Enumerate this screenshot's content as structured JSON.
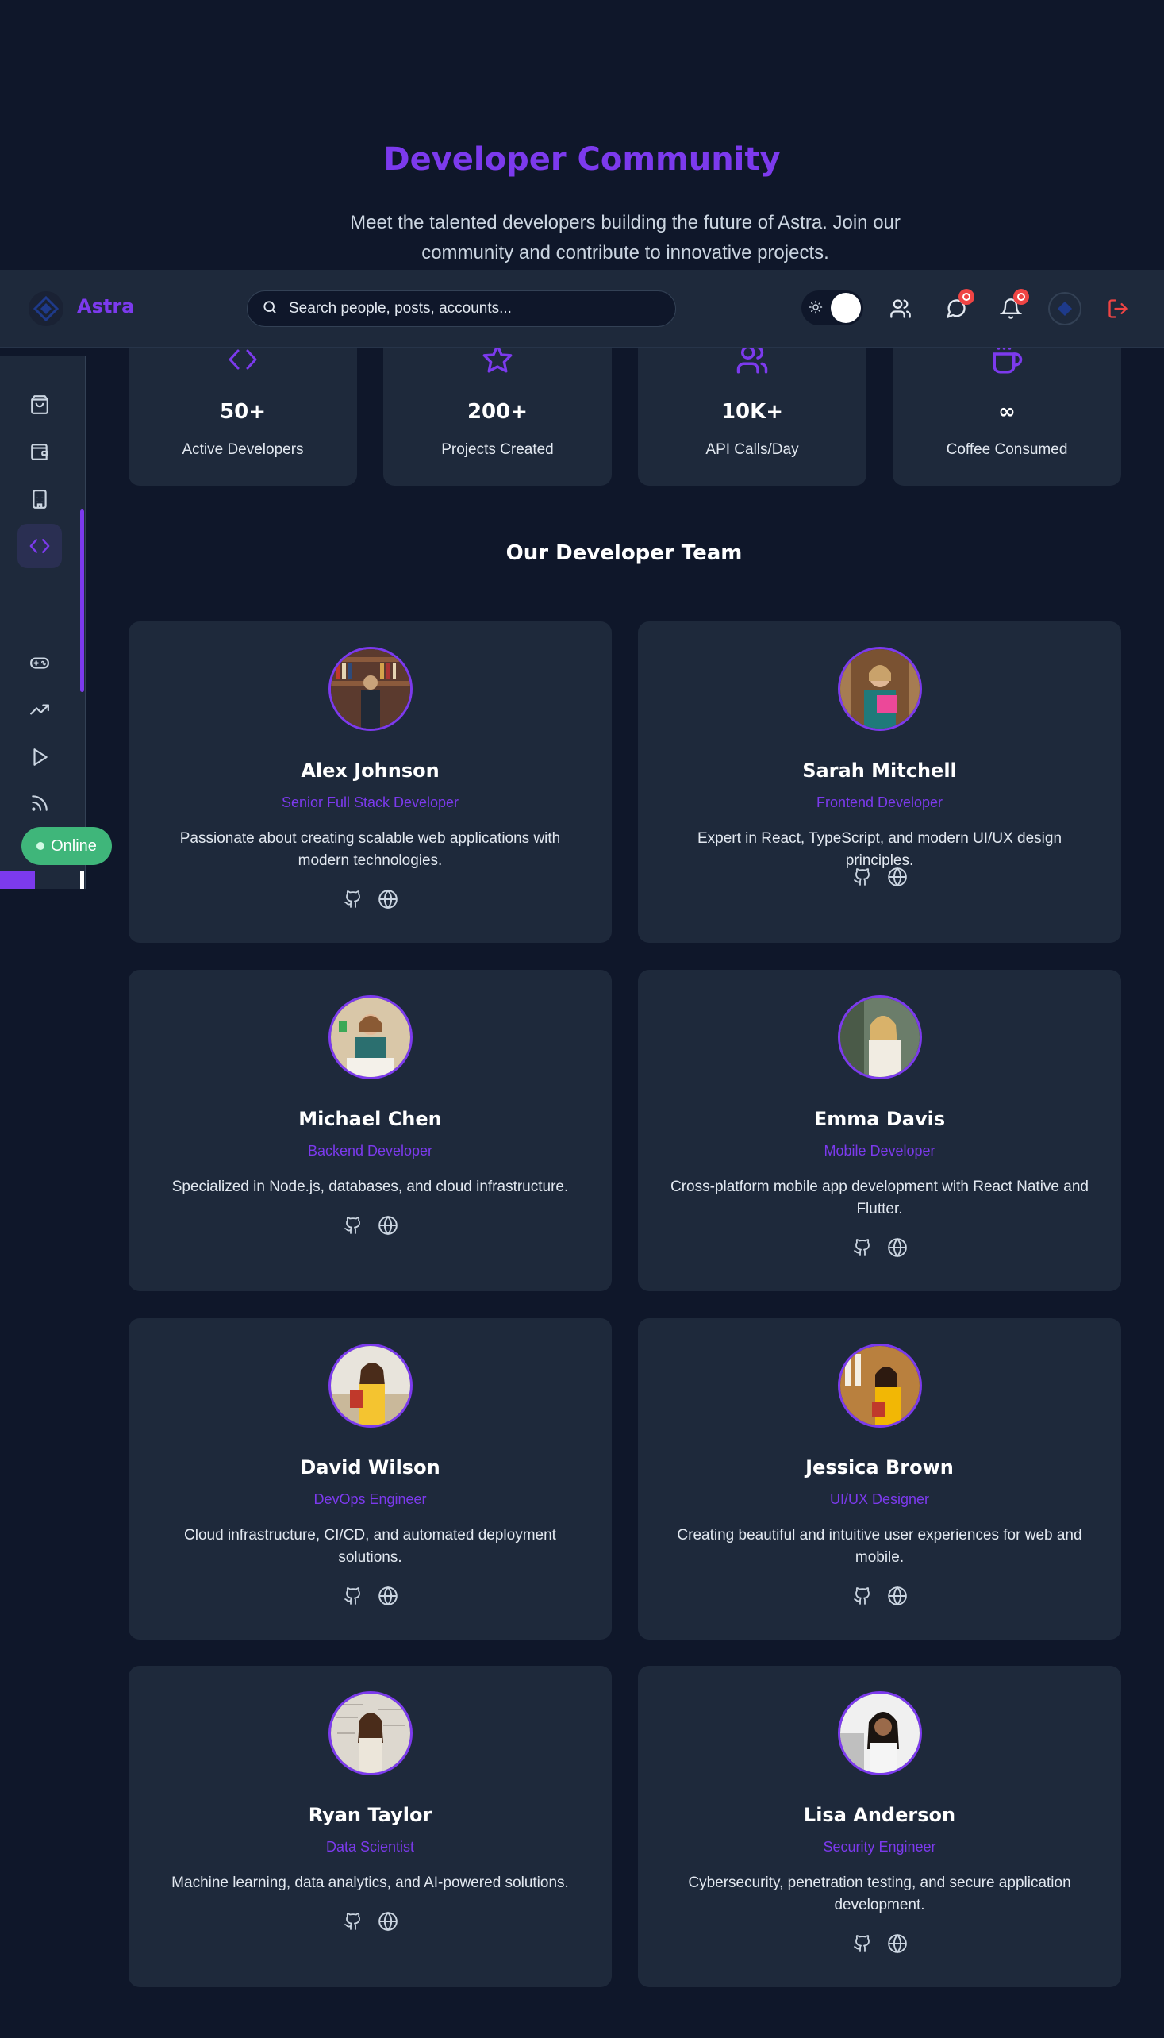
{
  "hero": {
    "title": "Developer Community",
    "subtitle": "Meet the talented developers building the future of Astra. Join our community and contribute to innovative projects."
  },
  "topbar": {
    "brand": "Astra",
    "search_placeholder": "Search people, posts, accounts...",
    "icons": [
      "users-icon",
      "messages-icon",
      "bell-icon",
      "avatar",
      "logout-icon"
    ],
    "theme_toggle": "light"
  },
  "sidebar": {
    "items": [
      "shopping-bag-icon",
      "wallet-icon",
      "building-icon",
      "code-icon",
      "gamepad-icon",
      "trending-up-icon",
      "play-icon",
      "rss-icon"
    ],
    "active": "code-icon",
    "status": "Online"
  },
  "stats": [
    {
      "icon": "code-icon",
      "value": "50+",
      "label": "Active Developers"
    },
    {
      "icon": "star-icon",
      "value": "200+",
      "label": "Projects Created"
    },
    {
      "icon": "users-icon",
      "value": "10K+",
      "label": "API Calls/Day"
    },
    {
      "icon": "coffee-icon",
      "value": "∞",
      "label": "Coffee Consumed"
    }
  ],
  "team": {
    "title": "Our Developer Team",
    "members": [
      {
        "name": "Alex Johnson",
        "role": "Senior Full Stack Developer",
        "bio": "Passionate about creating scalable web applications with modern technologies."
      },
      {
        "name": "Sarah Mitchell",
        "role": "Frontend Developer",
        "bio": "Expert in React, TypeScript, and modern UI/UX design principles."
      },
      {
        "name": "Michael Chen",
        "role": "Backend Developer",
        "bio": "Specialized in Node.js, databases, and cloud infrastructure."
      },
      {
        "name": "Emma Davis",
        "role": "Mobile Developer",
        "bio": "Cross-platform mobile app development with React Native and Flutter."
      },
      {
        "name": "David Wilson",
        "role": "DevOps Engineer",
        "bio": "Cloud infrastructure, CI/CD, and automated deployment solutions."
      },
      {
        "name": "Jessica Brown",
        "role": "UI/UX Designer",
        "bio": "Creating beautiful and intuitive user experiences for web and mobile."
      },
      {
        "name": "Ryan Taylor",
        "role": "Data Scientist",
        "bio": "Machine learning, data analytics, and AI-powered solutions."
      },
      {
        "name": "Lisa Anderson",
        "role": "Security Engineer",
        "bio": "Cybersecurity, penetration testing, and secure application development."
      }
    ]
  },
  "colors": {
    "accent": "#7c3aed",
    "background": "#0f172a",
    "surface": "#1e293b",
    "online": "#3fb67a",
    "danger": "#ef4444"
  }
}
